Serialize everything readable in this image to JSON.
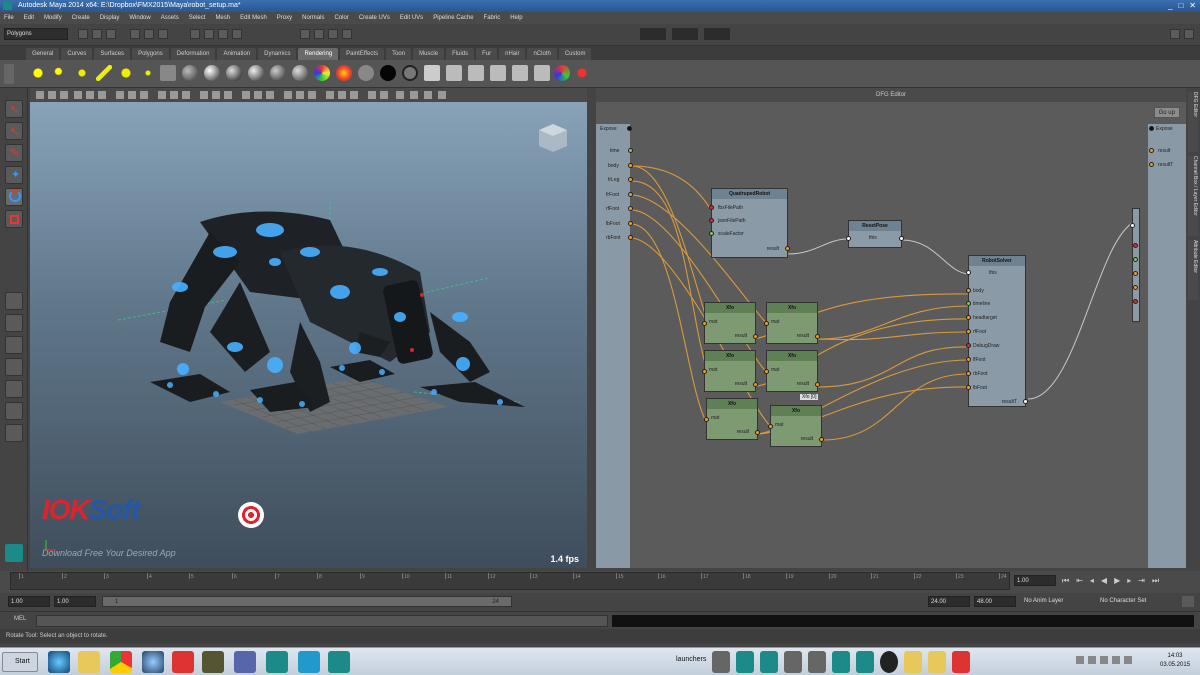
{
  "window": {
    "title": "Autodesk Maya 2014 x64: E:\\Dropbox\\FMX2015\\Maya\\robot_setup.ma*",
    "controls": [
      "_",
      "□",
      "✕"
    ]
  },
  "menubar": [
    "File",
    "Edit",
    "Modify",
    "Create",
    "Display",
    "Window",
    "Assets",
    "Select",
    "Mesh",
    "Edit Mesh",
    "Proxy",
    "Normals",
    "Color",
    "Create UVs",
    "Edit UVs",
    "Pipeline Cache",
    "Fabric",
    "Help"
  ],
  "statusline": {
    "mode_select": "Polygons"
  },
  "shelf_tabs": [
    {
      "label": "General",
      "active": false
    },
    {
      "label": "Curves",
      "active": false
    },
    {
      "label": "Surfaces",
      "active": false
    },
    {
      "label": "Polygons",
      "active": false
    },
    {
      "label": "Deformation",
      "active": false
    },
    {
      "label": "Animation",
      "active": false
    },
    {
      "label": "Dynamics",
      "active": false
    },
    {
      "label": "Rendering",
      "active": true
    },
    {
      "label": "PaintEffects",
      "active": false
    },
    {
      "label": "Toon",
      "active": false
    },
    {
      "label": "Muscle",
      "active": false
    },
    {
      "label": "Fluids",
      "active": false
    },
    {
      "label": "Fur",
      "active": false
    },
    {
      "label": "nHair",
      "active": false
    },
    {
      "label": "nCloth",
      "active": false
    },
    {
      "label": "Custom",
      "active": false
    }
  ],
  "viewport": {
    "fps": "1.4 fps",
    "watermark_a": "IOK",
    "watermark_b": "Soft",
    "watermark_tagline": "Download Free Your Desired App"
  },
  "node_editor": {
    "title": "DFG Editor",
    "go_up": "Go up",
    "left_ports": {
      "title": "Expose",
      "items": [
        "time",
        "body",
        "frLeg",
        "frFoot",
        "rfFoot",
        "lbFoot",
        "rbFoot"
      ]
    },
    "right_ports": {
      "title": "Expose",
      "items": [
        "result",
        "resultT"
      ]
    },
    "nodes": {
      "quad": {
        "title": "QuadrupedRobot",
        "ports": [
          "fbxFilePath",
          "jsonFilePath",
          "scaleFactor"
        ],
        "output": "result"
      },
      "reset": {
        "title": "ResetPose",
        "ports": [
          "this"
        ]
      },
      "solver": {
        "title": "RobotSolver",
        "ports": [
          "this",
          "body",
          "timeline",
          "headtarget",
          "rfFoot",
          "DebugDraw",
          "lfFoot",
          "rbFoot",
          "lbFoot"
        ],
        "output": "resultT"
      },
      "xfo_input": "mat",
      "xfo_output": "result",
      "xfo_title": "Xfo",
      "tooltip": "Xfo [0]"
    }
  },
  "timeline": {
    "ticks": [
      "1",
      "2",
      "3",
      "4",
      "5",
      "6",
      "7",
      "8",
      "9",
      "10",
      "11",
      "12",
      "13",
      "14",
      "15",
      "16",
      "17",
      "18",
      "19",
      "20",
      "21",
      "22",
      "23",
      "24"
    ],
    "current_frame": "1.00"
  },
  "range": {
    "start": "1.00",
    "playback_start": "1.00",
    "slider_start": "1",
    "slider_end": "24",
    "playback_end": "24.00",
    "end": "48.00",
    "anim_layer": "No Anim Layer",
    "char_set": "No Character Set"
  },
  "cmdline": {
    "label": "MEL"
  },
  "helpline": "Rotate Tool: Select an object to rotate.",
  "taskbar": {
    "start": "Start",
    "launchers": "launchers",
    "time": "14:03",
    "date": "03.05.2015"
  },
  "side_tabs": [
    "DFG Editor",
    "Channel Box / Layer Editor",
    "Attribute Editor"
  ],
  "colors": {
    "port_orange": "#f0a020",
    "port_green": "#7ed04c",
    "port_red": "#d03030",
    "wire": "#d89a3c",
    "accent_blue": "#2457a6"
  }
}
